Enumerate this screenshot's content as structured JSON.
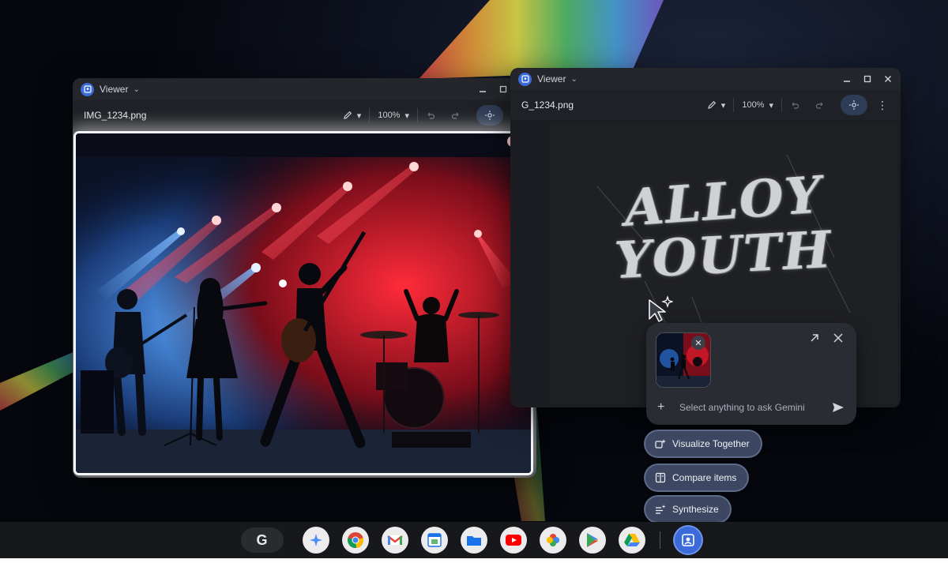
{
  "windows": {
    "left": {
      "app_title": "Viewer",
      "file_name": "IMG_1234.png",
      "zoom": "100%"
    },
    "right": {
      "app_title": "Viewer",
      "file_name": "G_1234.png",
      "zoom": "100%",
      "poster_text": {
        "line1": "ALLOY",
        "line2": "YOUTH"
      }
    }
  },
  "gemini": {
    "placeholder": "Select anything to ask Gemini"
  },
  "chips": [
    {
      "label": "Visualize Together",
      "icon": "sparkle-image-icon"
    },
    {
      "label": "Compare items",
      "icon": "compare-icon"
    },
    {
      "label": "Synthesize",
      "icon": "synthesize-icon"
    }
  ],
  "shelf": {
    "launcher_label": "G",
    "apps": [
      {
        "name": "gemini",
        "color": "#4c8bf5"
      },
      {
        "name": "chrome",
        "color": "#db4437"
      },
      {
        "name": "gmail",
        "color": "#ea4335"
      },
      {
        "name": "calendar",
        "color": "#1a73e8"
      },
      {
        "name": "files",
        "color": "#1a73e8"
      },
      {
        "name": "youtube",
        "color": "#ff0000"
      },
      {
        "name": "photos",
        "color": "#fbbc04"
      },
      {
        "name": "play-store",
        "color": "#34a853"
      },
      {
        "name": "drive",
        "color": "#0f9d58"
      }
    ],
    "active_app": "gallery-viewer"
  },
  "colors": {
    "accent": "#3a6bd8",
    "chip_bg": "#3e4761",
    "window_bg": "#1b1d22"
  }
}
